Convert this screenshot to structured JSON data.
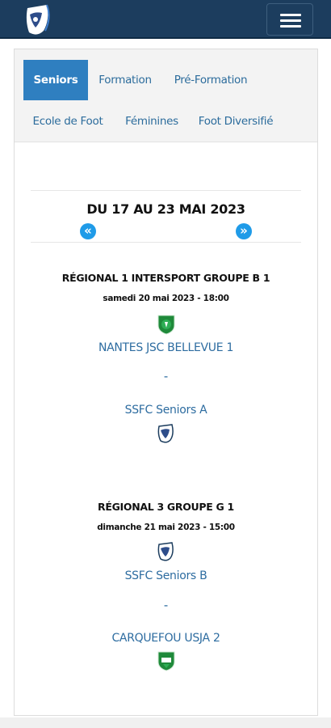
{
  "header": {
    "logo_icon": "club-shield-logo",
    "menu_icon": "hamburger-menu-icon",
    "brand_color": "#1c3d5e"
  },
  "tabs": [
    {
      "label": "Seniors",
      "active": true
    },
    {
      "label": "Formation",
      "active": false
    },
    {
      "label": "Pré-Formation",
      "active": false
    },
    {
      "label": "Ecole de Foot",
      "active": false
    },
    {
      "label": "Féminines",
      "active": false
    },
    {
      "label": "Foot Diversifié",
      "active": false
    }
  ],
  "week": {
    "title": "DU 17 AU 23 MAI 2023",
    "prev_icon": "double-chevron-left-icon",
    "next_icon": "double-chevron-right-icon",
    "prev_symbol": "«",
    "next_symbol": "»"
  },
  "matches": [
    {
      "competition": "RÉGIONAL 1 INTERSPORT GROUPE B 1",
      "datetime": "samedi 20 mai 2023 - 18:00",
      "home": {
        "name": "NANTES JSC BELLEVUE 1",
        "crest": "green-club-crest-icon"
      },
      "separator": "-",
      "away": {
        "name": "SSFC Seniors A",
        "crest": "club-shield-crest-icon"
      }
    },
    {
      "competition": "RÉGIONAL 3 GROUPE G 1",
      "datetime": "dimanche 21 mai 2023 - 15:00",
      "home": {
        "name": "SSFC Seniors B",
        "crest": "club-shield-crest-icon"
      },
      "separator": "-",
      "away": {
        "name": "CARQUEFOU USJA 2",
        "crest": "green-club-crest-icon"
      }
    }
  ],
  "colors": {
    "active_tab": "#2f7fc0",
    "link": "#2d6ca0",
    "nav_arrow": "#1f9be8"
  }
}
